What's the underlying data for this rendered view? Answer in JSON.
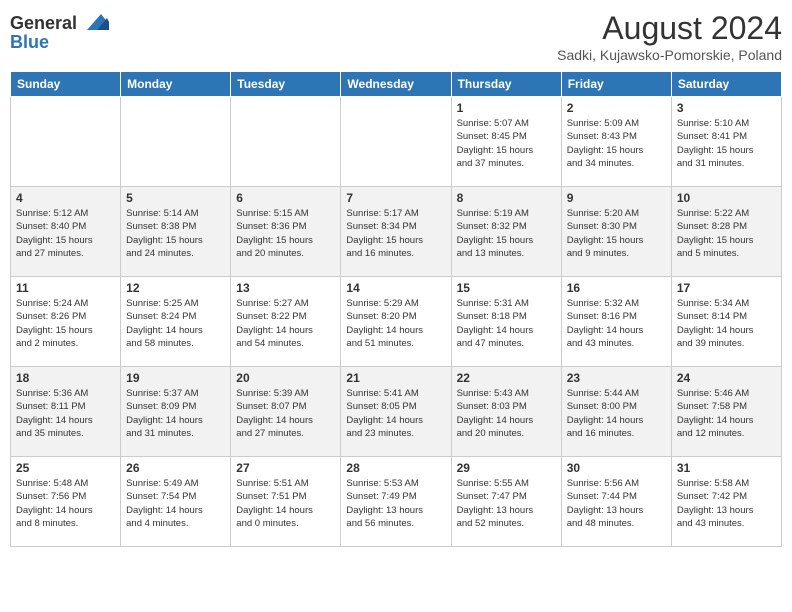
{
  "header": {
    "logo_line1": "General",
    "logo_line2": "Blue",
    "month": "August 2024",
    "location": "Sadki, Kujawsko-Pomorskie, Poland"
  },
  "days_of_week": [
    "Sunday",
    "Monday",
    "Tuesday",
    "Wednesday",
    "Thursday",
    "Friday",
    "Saturday"
  ],
  "weeks": [
    [
      {
        "day": "",
        "info": ""
      },
      {
        "day": "",
        "info": ""
      },
      {
        "day": "",
        "info": ""
      },
      {
        "day": "",
        "info": ""
      },
      {
        "day": "1",
        "info": "Sunrise: 5:07 AM\nSunset: 8:45 PM\nDaylight: 15 hours\nand 37 minutes."
      },
      {
        "day": "2",
        "info": "Sunrise: 5:09 AM\nSunset: 8:43 PM\nDaylight: 15 hours\nand 34 minutes."
      },
      {
        "day": "3",
        "info": "Sunrise: 5:10 AM\nSunset: 8:41 PM\nDaylight: 15 hours\nand 31 minutes."
      }
    ],
    [
      {
        "day": "4",
        "info": "Sunrise: 5:12 AM\nSunset: 8:40 PM\nDaylight: 15 hours\nand 27 minutes."
      },
      {
        "day": "5",
        "info": "Sunrise: 5:14 AM\nSunset: 8:38 PM\nDaylight: 15 hours\nand 24 minutes."
      },
      {
        "day": "6",
        "info": "Sunrise: 5:15 AM\nSunset: 8:36 PM\nDaylight: 15 hours\nand 20 minutes."
      },
      {
        "day": "7",
        "info": "Sunrise: 5:17 AM\nSunset: 8:34 PM\nDaylight: 15 hours\nand 16 minutes."
      },
      {
        "day": "8",
        "info": "Sunrise: 5:19 AM\nSunset: 8:32 PM\nDaylight: 15 hours\nand 13 minutes."
      },
      {
        "day": "9",
        "info": "Sunrise: 5:20 AM\nSunset: 8:30 PM\nDaylight: 15 hours\nand 9 minutes."
      },
      {
        "day": "10",
        "info": "Sunrise: 5:22 AM\nSunset: 8:28 PM\nDaylight: 15 hours\nand 5 minutes."
      }
    ],
    [
      {
        "day": "11",
        "info": "Sunrise: 5:24 AM\nSunset: 8:26 PM\nDaylight: 15 hours\nand 2 minutes."
      },
      {
        "day": "12",
        "info": "Sunrise: 5:25 AM\nSunset: 8:24 PM\nDaylight: 14 hours\nand 58 minutes."
      },
      {
        "day": "13",
        "info": "Sunrise: 5:27 AM\nSunset: 8:22 PM\nDaylight: 14 hours\nand 54 minutes."
      },
      {
        "day": "14",
        "info": "Sunrise: 5:29 AM\nSunset: 8:20 PM\nDaylight: 14 hours\nand 51 minutes."
      },
      {
        "day": "15",
        "info": "Sunrise: 5:31 AM\nSunset: 8:18 PM\nDaylight: 14 hours\nand 47 minutes."
      },
      {
        "day": "16",
        "info": "Sunrise: 5:32 AM\nSunset: 8:16 PM\nDaylight: 14 hours\nand 43 minutes."
      },
      {
        "day": "17",
        "info": "Sunrise: 5:34 AM\nSunset: 8:14 PM\nDaylight: 14 hours\nand 39 minutes."
      }
    ],
    [
      {
        "day": "18",
        "info": "Sunrise: 5:36 AM\nSunset: 8:11 PM\nDaylight: 14 hours\nand 35 minutes."
      },
      {
        "day": "19",
        "info": "Sunrise: 5:37 AM\nSunset: 8:09 PM\nDaylight: 14 hours\nand 31 minutes."
      },
      {
        "day": "20",
        "info": "Sunrise: 5:39 AM\nSunset: 8:07 PM\nDaylight: 14 hours\nand 27 minutes."
      },
      {
        "day": "21",
        "info": "Sunrise: 5:41 AM\nSunset: 8:05 PM\nDaylight: 14 hours\nand 23 minutes."
      },
      {
        "day": "22",
        "info": "Sunrise: 5:43 AM\nSunset: 8:03 PM\nDaylight: 14 hours\nand 20 minutes."
      },
      {
        "day": "23",
        "info": "Sunrise: 5:44 AM\nSunset: 8:00 PM\nDaylight: 14 hours\nand 16 minutes."
      },
      {
        "day": "24",
        "info": "Sunrise: 5:46 AM\nSunset: 7:58 PM\nDaylight: 14 hours\nand 12 minutes."
      }
    ],
    [
      {
        "day": "25",
        "info": "Sunrise: 5:48 AM\nSunset: 7:56 PM\nDaylight: 14 hours\nand 8 minutes."
      },
      {
        "day": "26",
        "info": "Sunrise: 5:49 AM\nSunset: 7:54 PM\nDaylight: 14 hours\nand 4 minutes."
      },
      {
        "day": "27",
        "info": "Sunrise: 5:51 AM\nSunset: 7:51 PM\nDaylight: 14 hours\nand 0 minutes."
      },
      {
        "day": "28",
        "info": "Sunrise: 5:53 AM\nSunset: 7:49 PM\nDaylight: 13 hours\nand 56 minutes."
      },
      {
        "day": "29",
        "info": "Sunrise: 5:55 AM\nSunset: 7:47 PM\nDaylight: 13 hours\nand 52 minutes."
      },
      {
        "day": "30",
        "info": "Sunrise: 5:56 AM\nSunset: 7:44 PM\nDaylight: 13 hours\nand 48 minutes."
      },
      {
        "day": "31",
        "info": "Sunrise: 5:58 AM\nSunset: 7:42 PM\nDaylight: 13 hours\nand 43 minutes."
      }
    ]
  ]
}
